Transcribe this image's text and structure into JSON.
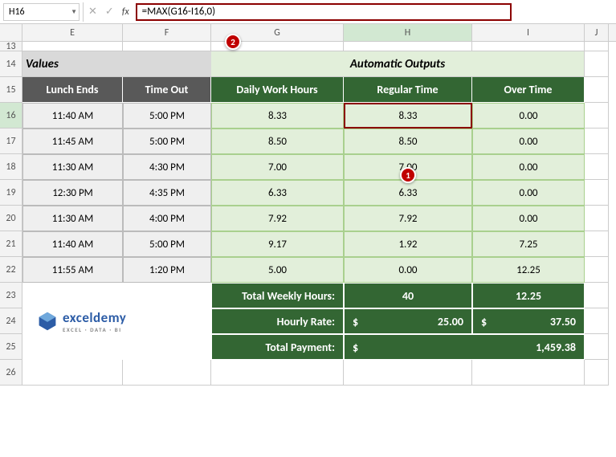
{
  "name_box": "H16",
  "formula": "=MAX(G16-I16,0)",
  "columns": [
    "E",
    "F",
    "G",
    "H",
    "I",
    "J"
  ],
  "active_col": "H",
  "row_nums": [
    "13",
    "14",
    "15",
    "16",
    "17",
    "18",
    "19",
    "20",
    "21",
    "22",
    "23",
    "24",
    "25",
    "26"
  ],
  "active_row": "16",
  "section_values_label": "Values",
  "section_auto_label": "Automatic Outputs",
  "headers": {
    "lunch_ends": "Lunch Ends",
    "time_out": "Time Out",
    "daily_hours": "Daily Work Hours",
    "regular_time": "Regular Time",
    "over_time": "Over Time"
  },
  "rows": [
    {
      "lunch": "11:40 AM",
      "out": "5:00 PM",
      "daily": "8.33",
      "reg": "8.33",
      "ot": "0.00"
    },
    {
      "lunch": "11:45 AM",
      "out": "5:00 PM",
      "daily": "8.50",
      "reg": "8.50",
      "ot": "0.00"
    },
    {
      "lunch": "11:30 AM",
      "out": "4:30 PM",
      "daily": "7.00",
      "reg": "7.00",
      "ot": "0.00"
    },
    {
      "lunch": "12:30 PM",
      "out": "4:35 PM",
      "daily": "6.33",
      "reg": "6.33",
      "ot": "0.00"
    },
    {
      "lunch": "11:30 AM",
      "out": "4:00 PM",
      "daily": "7.92",
      "reg": "7.92",
      "ot": "0.00"
    },
    {
      "lunch": "11:40 AM",
      "out": "5:00 PM",
      "daily": "9.17",
      "reg": "1.92",
      "ot": "7.25"
    },
    {
      "lunch": "11:55 AM",
      "out": "1:20 PM",
      "daily": "5.00",
      "reg": "0.00",
      "ot": "12.25"
    }
  ],
  "summary": {
    "total_weekly_label": "Total Weekly Hours:",
    "total_weekly_reg": "40",
    "total_weekly_ot": "12.25",
    "hourly_rate_label": "Hourly Rate:",
    "hourly_rate_reg": "25.00",
    "hourly_rate_ot": "37.50",
    "total_payment_label": "Total Payment:",
    "total_payment": "1,459.38",
    "dollar": "$"
  },
  "logo": {
    "brand": "exceldemy",
    "tag": "EXCEL · DATA · BI"
  },
  "callouts": {
    "one": "1",
    "two": "2"
  }
}
